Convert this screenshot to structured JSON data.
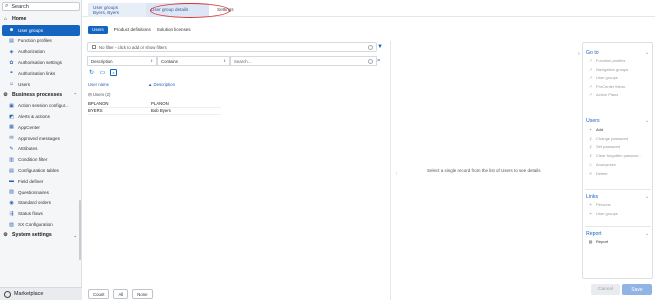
{
  "sidebar": {
    "search_label": "Search",
    "items": [
      {
        "label": "Home",
        "icon": "home-icon",
        "type": "top"
      },
      {
        "label": "User groups",
        "icon": "users-icon",
        "type": "active"
      },
      {
        "label": "Function profiles",
        "icon": "profile-icon"
      },
      {
        "label": "Authorization",
        "icon": "shield-icon"
      },
      {
        "label": "Authorisation settings",
        "icon": "settings-icon"
      },
      {
        "label": "Authorisation links",
        "icon": "link-icon"
      },
      {
        "label": "Users",
        "icon": "user-icon"
      },
      {
        "label": "Business processes",
        "icon": "process-icon",
        "type": "top",
        "chevron": "^"
      },
      {
        "label": "Action session configur...",
        "icon": "action-icon"
      },
      {
        "label": "Alerts & actions",
        "icon": "alert-icon"
      },
      {
        "label": "AppCenter",
        "icon": "apps-icon"
      },
      {
        "label": "Approved messages",
        "icon": "message-icon"
      },
      {
        "label": "Attributes",
        "icon": "attribute-icon"
      },
      {
        "label": "Condition filter",
        "icon": "filter-icon"
      },
      {
        "label": "Configuration tables",
        "icon": "table-icon"
      },
      {
        "label": "Field definer",
        "icon": "field-icon"
      },
      {
        "label": "Questionnaires",
        "icon": "questionnaire-icon"
      },
      {
        "label": "Standard orders",
        "icon": "order-icon"
      },
      {
        "label": "Status flows",
        "icon": "flow-icon"
      },
      {
        "label": "SX Configuration",
        "icon": "config-icon"
      },
      {
        "label": "System settings",
        "icon": "gear-icon",
        "type": "top",
        "chevron": "v"
      }
    ],
    "marketplace_label": "Marketplace"
  },
  "tabs": [
    {
      "line1": "User groups",
      "line2": "Byers, Byers"
    },
    {
      "line1": "User group details"
    },
    {
      "line1": "Settings"
    }
  ],
  "subtabs": [
    "Users",
    "Product definitions",
    "Solution licenses"
  ],
  "grid": {
    "filter_text": "No filter - click to add or show filters",
    "condition": {
      "field": "Description",
      "operator": "Contains",
      "value_placeholder": "Search..."
    },
    "columns": [
      "User name",
      "Description"
    ],
    "sort_indicator": "▲",
    "group_label": "Users (2)",
    "rows": [
      {
        "user": "BPLANON",
        "description": "PLANON"
      },
      {
        "user": "BYERS",
        "description": "Bob Byers"
      }
    ],
    "bottom_buttons": [
      "Count",
      "All",
      "None"
    ]
  },
  "detail": {
    "message": "Select a single record from the list of Users to see details"
  },
  "actions": {
    "goto": {
      "title": "Go to",
      "items": [
        "Function profiles",
        "Navigation groups",
        "User groups",
        "ProCenter Menu",
        "Action Plans"
      ]
    },
    "users": {
      "title": "Users",
      "items": [
        {
          "label": "Add",
          "enabled": true
        },
        {
          "label": "Change password",
          "enabled": false
        },
        {
          "label": "Set password",
          "enabled": false
        },
        {
          "label": "Clear forgotten passwor...",
          "enabled": false
        },
        {
          "label": "Anonymize",
          "enabled": false
        },
        {
          "label": "Delete",
          "enabled": false
        }
      ]
    },
    "links": {
      "title": "Links",
      "items": [
        "Persons",
        "User groups"
      ]
    },
    "report": {
      "title": "Report",
      "items": [
        "Report"
      ]
    }
  },
  "footer": {
    "cancel_label": "Cancel",
    "save_label": "Save"
  },
  "colors": {
    "accent": "#1565c0",
    "annotation": "#dd3333",
    "save_disabled": "#90b4e4"
  }
}
